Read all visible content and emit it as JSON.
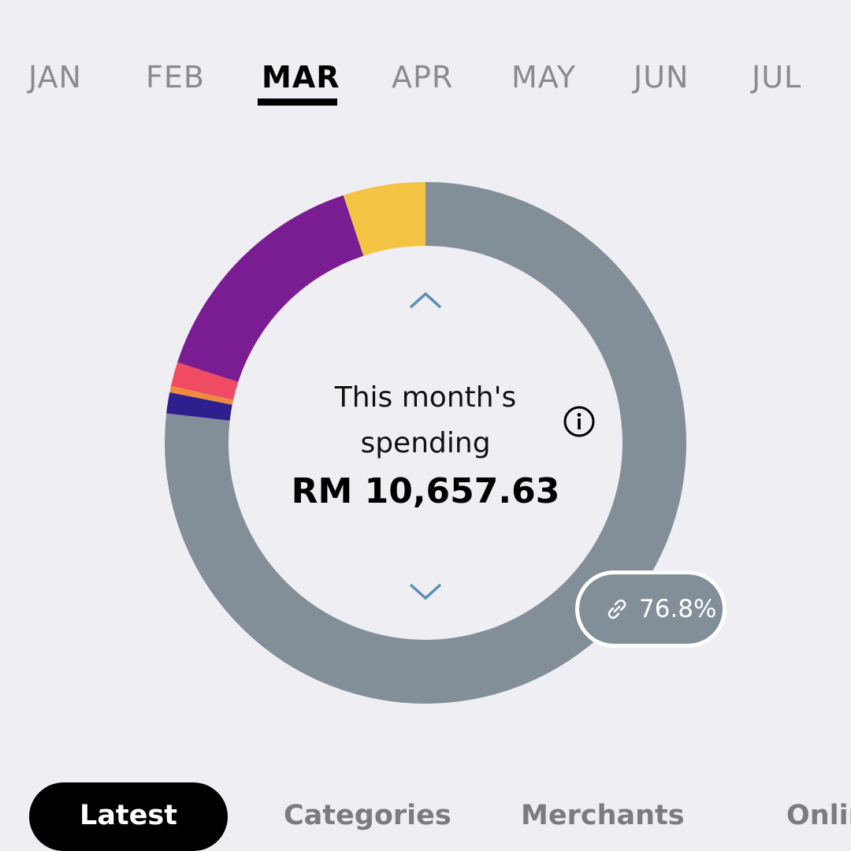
{
  "months": {
    "items": [
      "JAN",
      "FEB",
      "MAR",
      "APR",
      "MAY",
      "JUN",
      "JUL"
    ],
    "selected": "MAR"
  },
  "spending": {
    "title": "This month's spending",
    "amount": "RM 10,657.63"
  },
  "selected_segment": {
    "percent_label": "76.8%",
    "icon": "link-icon"
  },
  "chart_data": {
    "type": "pie",
    "slices": [
      {
        "value": 76.8,
        "color": "#828f99"
      },
      {
        "value": 1.3,
        "color": "#2e1f8e"
      },
      {
        "value": 0.4,
        "color": "#f08a3c"
      },
      {
        "value": 1.5,
        "color": "#ef4b62"
      },
      {
        "value": 14.9,
        "color": "#7a1c92"
      },
      {
        "value": 5.1,
        "color": "#f3c443"
      }
    ]
  },
  "tabs": {
    "items": [
      "Latest",
      "Categories",
      "Merchants",
      "Online"
    ],
    "selected": "Latest"
  },
  "colors": {
    "background": "#efeef3",
    "chevron": "#5b8fb4",
    "active": "#000000",
    "inactive_text": "#8a8a8f"
  }
}
